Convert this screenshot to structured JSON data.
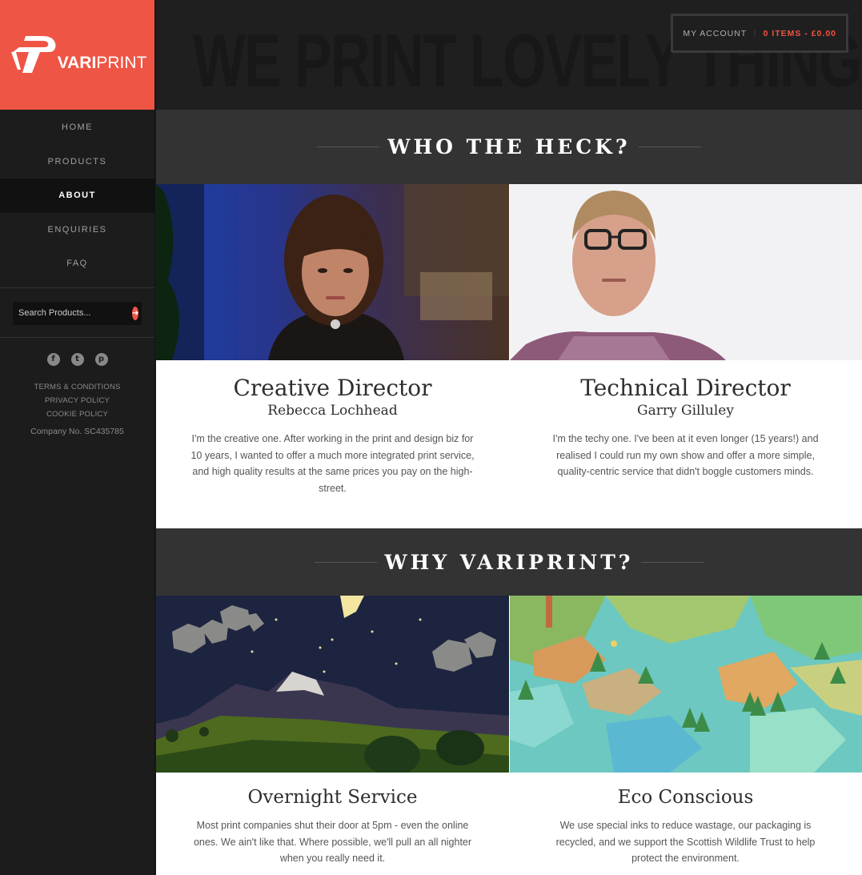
{
  "brand": {
    "name_bold": "VARI",
    "name_light": "PRINT",
    "color": "#ef5544"
  },
  "nav": {
    "items": [
      {
        "label": "HOME",
        "active": false
      },
      {
        "label": "PRODUCTS",
        "active": false
      },
      {
        "label": "ABOUT",
        "active": true
      },
      {
        "label": "ENQUIRIES",
        "active": false
      },
      {
        "label": "FAQ",
        "active": false
      }
    ]
  },
  "search": {
    "placeholder": "Search Products...",
    "button_icon": "arrow-right-icon"
  },
  "social": [
    {
      "icon": "facebook-icon",
      "glyph": "f"
    },
    {
      "icon": "twitter-icon",
      "glyph": "t"
    },
    {
      "icon": "pinterest-icon",
      "glyph": "p"
    }
  ],
  "footer_links": [
    "TERMS & CONDITIONS",
    "PRIVACY POLICY",
    "COOKIE POLICY"
  ],
  "company_number": "Company No. SC435785",
  "hero": {
    "tagline": "WE PRINT LOVELY THINGS"
  },
  "account": {
    "label": "MY ACCOUNT",
    "cart": "0 ITEMS - £0.00"
  },
  "section_team": {
    "title": "WHO THE HECK?",
    "members": [
      {
        "role": "Creative Director",
        "name": "Rebecca Lochhead",
        "bio": "I'm the creative one. After working in the print and design biz for 10 years, I wanted to offer a much more integrated print service, and high quality results at the same prices you pay on the high-street."
      },
      {
        "role": "Technical Director",
        "name": "Garry Gilluley",
        "bio": "I'm the techy one. I've been at it even longer (15 years!) and realised I could run my own show and offer a more simple, quality-centric service that didn't boggle customers minds."
      }
    ]
  },
  "section_why": {
    "title": "WHY VARIPRINT?",
    "features": [
      {
        "title": "Overnight Service",
        "text": "Most print companies shut their door at 5pm - even the online ones. We ain't like that. Where possible, we'll pull an all nighter when you really need it."
      },
      {
        "title": "Eco Conscious",
        "text": "We use special inks to reduce wastage, our packaging is recycled, and we support the Scottish Wildlife Trust to help protect the environment."
      }
    ]
  }
}
